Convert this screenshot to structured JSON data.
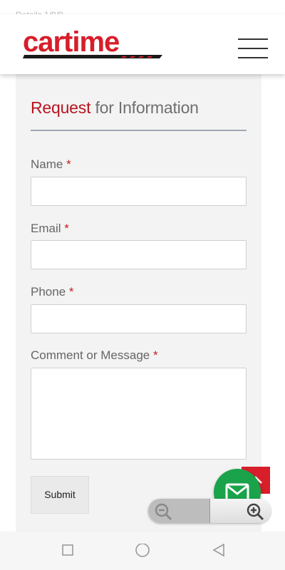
{
  "status_bar": {
    "time": "Details 1/9/9"
  },
  "header": {
    "logo_text": "cartime"
  },
  "form": {
    "title_accent": "Request",
    "title_rest": " for Information",
    "required_mark": "*",
    "fields": [
      {
        "label": "Name",
        "value": ""
      },
      {
        "label": "Email",
        "value": ""
      },
      {
        "label": "Phone",
        "value": ""
      },
      {
        "label": "Comment or Message",
        "value": ""
      }
    ],
    "submit_label": "Submit"
  },
  "colors": {
    "brand_red": "#d71e2a",
    "chat_green": "#1aa34a"
  },
  "icons": {
    "menu": "hamburger-menu-icon",
    "scroll_top": "chevron-up-icon",
    "chat": "envelope-icon",
    "zoom_out": "zoom-out-icon",
    "zoom_in": "zoom-in-icon",
    "nav": [
      "square-recents-icon",
      "circle-home-icon",
      "triangle-back-icon"
    ]
  }
}
